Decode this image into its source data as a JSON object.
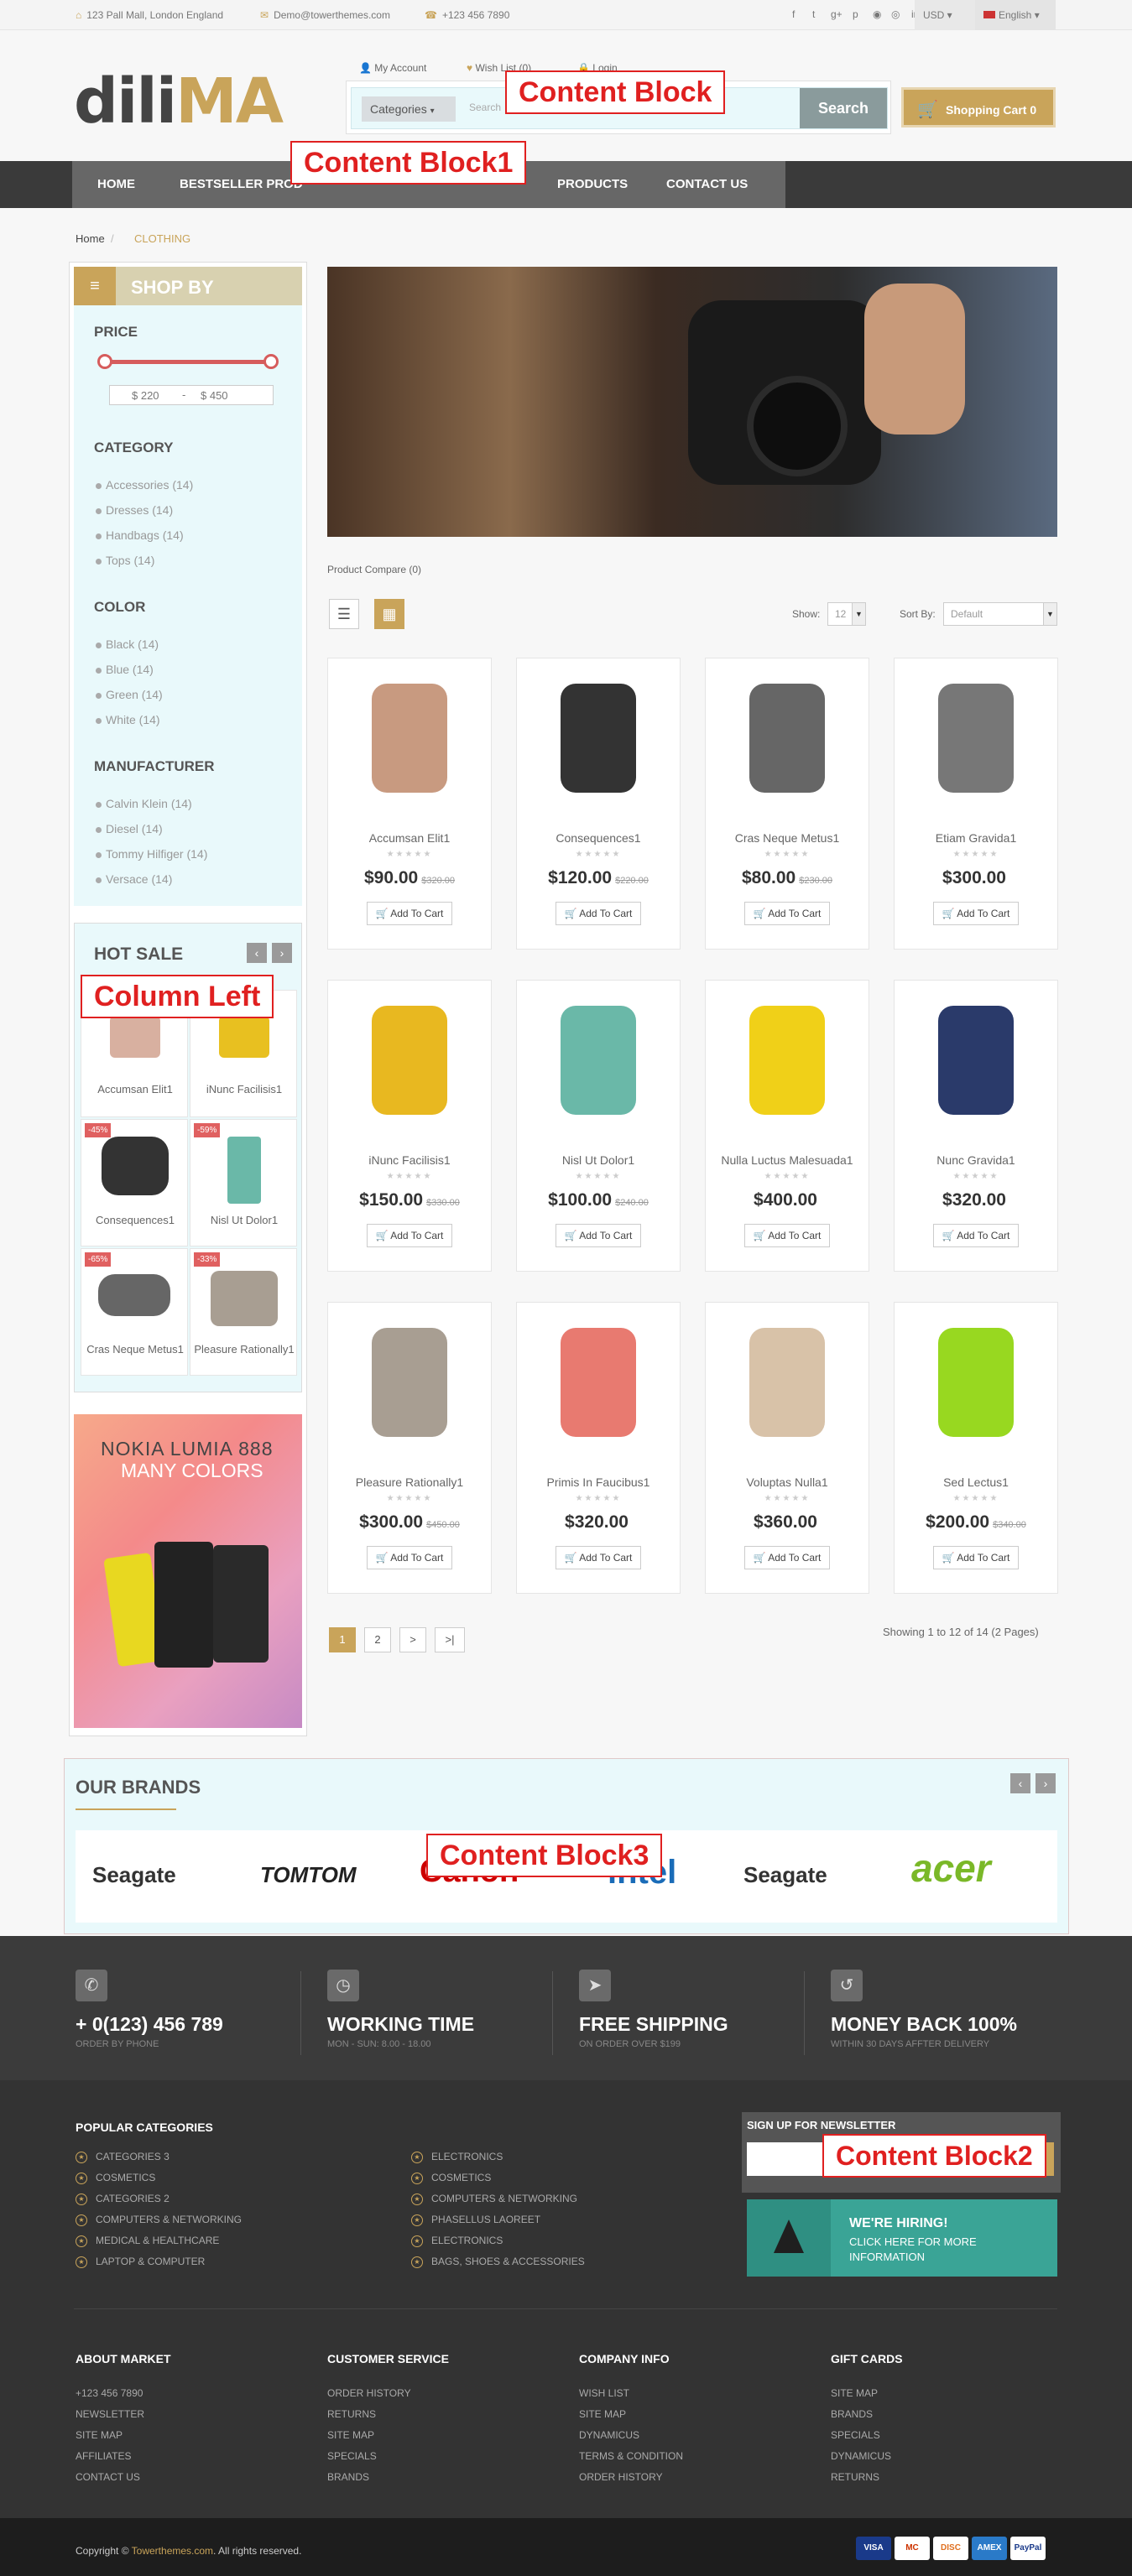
{
  "topbar": {
    "address": "123 Pall Mall, London England",
    "email": "Demo@towerthemes.com",
    "phone": "+123 456 7890",
    "currency": "USD",
    "language": "English"
  },
  "header": {
    "logo_a": "dili",
    "logo_b": "MA",
    "my_account": "My Account",
    "wish_list": "Wish List (0)",
    "login": "Login",
    "categories": "Categories",
    "search_placeholder": "Search",
    "search_button": "Search",
    "cart": "Shopping Cart 0"
  },
  "annotations": {
    "content_block": "Content Block",
    "content_block1": "Content Block1",
    "column_left": "Column Left",
    "content_block3": "Content Block3",
    "content_block2": "Content Block2"
  },
  "nav": {
    "items": [
      "HOME",
      "BESTSELLER PROD",
      "PRODUCTS",
      "CONTACT US"
    ]
  },
  "breadcrumb": {
    "home": "Home",
    "current": "CLOTHING"
  },
  "sidebar": {
    "title": "SHOP BY",
    "price_label": "PRICE",
    "price_min": "$ 220",
    "price_max": "$ 450",
    "category_label": "CATEGORY",
    "categories": [
      "Accessories (14)",
      "Dresses (14)",
      "Handbags (14)",
      "Tops (14)"
    ],
    "color_label": "COLOR",
    "colors": [
      "Black (14)",
      "Blue (14)",
      "Green (14)",
      "White (14)"
    ],
    "manufacturer_label": "MANUFACTURER",
    "manufacturers": [
      "Calvin Klein (14)",
      "Diesel (14)",
      "Tommy Hilfiger (14)",
      "Versace (14)"
    ]
  },
  "hot_sale": {
    "title": "HOT SALE",
    "items": [
      {
        "name": "Accumsan Elit1",
        "badge": ""
      },
      {
        "name": "iNunc Facilisis1",
        "badge": ""
      },
      {
        "name": "Consequences1",
        "badge": "-45%"
      },
      {
        "name": "Nisl Ut Dolor1",
        "badge": "-59%"
      },
      {
        "name": "Cras Neque Metus1",
        "badge": "-65%"
      },
      {
        "name": "Pleasure Rationally1",
        "badge": "-33%"
      }
    ]
  },
  "banner": {
    "line1": "NOKIA LUMIA 888",
    "line2": "MANY COLORS"
  },
  "toolbar": {
    "compare": "Product Compare (0)",
    "show_label": "Show:",
    "show_value": "12",
    "sort_label": "Sort By:",
    "sort_value": "Default"
  },
  "products": [
    {
      "name": "Accumsan Elit1",
      "price": "$90.00",
      "old": "$320.00",
      "add": "Add To Cart",
      "color": "#c89a80"
    },
    {
      "name": "Consequences1",
      "price": "$120.00",
      "old": "$220.00",
      "add": "Add To Cart",
      "color": "#333333"
    },
    {
      "name": "Cras Neque Metus1",
      "price": "$80.00",
      "old": "$230.00",
      "add": "Add To Cart",
      "color": "#666666"
    },
    {
      "name": "Etiam Gravida1",
      "price": "$300.00",
      "old": "",
      "add": "Add To Cart",
      "color": "#777777"
    },
    {
      "name": "iNunc Facilisis1",
      "price": "$150.00",
      "old": "$330.00",
      "add": "Add To Cart",
      "color": "#e8b820"
    },
    {
      "name": "Nisl Ut Dolor1",
      "price": "$100.00",
      "old": "$240.00",
      "add": "Add To Cart",
      "color": "#6ab8a8"
    },
    {
      "name": "Nulla Luctus Malesuada1",
      "price": "$400.00",
      "old": "",
      "add": "Add To Cart",
      "color": "#f0d018"
    },
    {
      "name": "Nunc Gravida1",
      "price": "$320.00",
      "old": "",
      "add": "Add To Cart",
      "color": "#2a3a6a"
    },
    {
      "name": "Pleasure Rationally1",
      "price": "$300.00",
      "old": "$450.00",
      "add": "Add To Cart",
      "color": "#a89e92"
    },
    {
      "name": "Primis In Faucibus1",
      "price": "$320.00",
      "old": "",
      "add": "Add To Cart",
      "color": "#e87a70"
    },
    {
      "name": "Voluptas Nulla1",
      "price": "$360.00",
      "old": "",
      "add": "Add To Cart",
      "color": "#d8c2a8"
    },
    {
      "name": "Sed Lectus1",
      "price": "$200.00",
      "old": "$340.00",
      "add": "Add To Cart",
      "color": "#98d820"
    }
  ],
  "pagination": {
    "pages": [
      "1",
      "2",
      ">",
      ">|"
    ],
    "summary": "Showing 1 to 12 of 14 (2 Pages)"
  },
  "brands": {
    "title": "OUR BRANDS",
    "list": [
      "Seagate",
      "TOMTOM",
      "Canon",
      "intel",
      "Seagate",
      "acer"
    ]
  },
  "features": [
    {
      "title": "+ 0(123) 456 789",
      "sub": "ORDER BY PHONE"
    },
    {
      "title": "WORKING TIME",
      "sub": "MON - SUN: 8.00 - 18.00"
    },
    {
      "title": "FREE SHIPPING",
      "sub": "ON ORDER OVER $199"
    },
    {
      "title": "MONEY BACK 100%",
      "sub": "WITHIN 30 DAYS AFFTER DELIVERY"
    }
  ],
  "popular": {
    "title": "POPULAR CATEGORIES",
    "col1": [
      "CATEGORIES 3",
      "COSMETICS",
      "CATEGORIES 2",
      "COMPUTERS & NETWORKING",
      "MEDICAL & HEALTHCARE",
      "LAPTOP & COMPUTER"
    ],
    "col2": [
      "ELECTRONICS",
      "COSMETICS",
      "COMPUTERS & NETWORKING",
      "PHASELLUS LAOREET",
      "ELECTRONICS",
      "BAGS, SHOES & ACCESSORIES"
    ]
  },
  "newsletter": {
    "title": "SIGN UP FOR NEWSLETTER"
  },
  "hiring": {
    "title": "WE'RE HIRING!",
    "text": "CLICK HERE FOR MORE INFORMATION"
  },
  "footer_cols": [
    {
      "title": "ABOUT MARKET",
      "links": [
        "+123 456 7890",
        "NEWSLETTER",
        "SITE MAP",
        "AFFILIATES",
        "CONTACT US"
      ]
    },
    {
      "title": "CUSTOMER SERVICE",
      "links": [
        "ORDER HISTORY",
        "RETURNS",
        "SITE MAP",
        "SPECIALS",
        "BRANDS"
      ]
    },
    {
      "title": "COMPANY INFO",
      "links": [
        "WISH LIST",
        "SITE MAP",
        "DYNAMICUS",
        "TERMS & CONDITION",
        "ORDER HISTORY"
      ]
    },
    {
      "title": "GIFT CARDS",
      "links": [
        "SITE MAP",
        "BRANDS",
        "SPECIALS",
        "DYNAMICUS",
        "RETURNS"
      ]
    }
  ],
  "copyright": {
    "prefix": "Copyright ©",
    "link": "Towerthemes.com",
    "suffix": ". All rights reserved."
  },
  "payments": [
    "VISA",
    "MC",
    "DISC",
    "AMEX",
    "PayPal"
  ]
}
